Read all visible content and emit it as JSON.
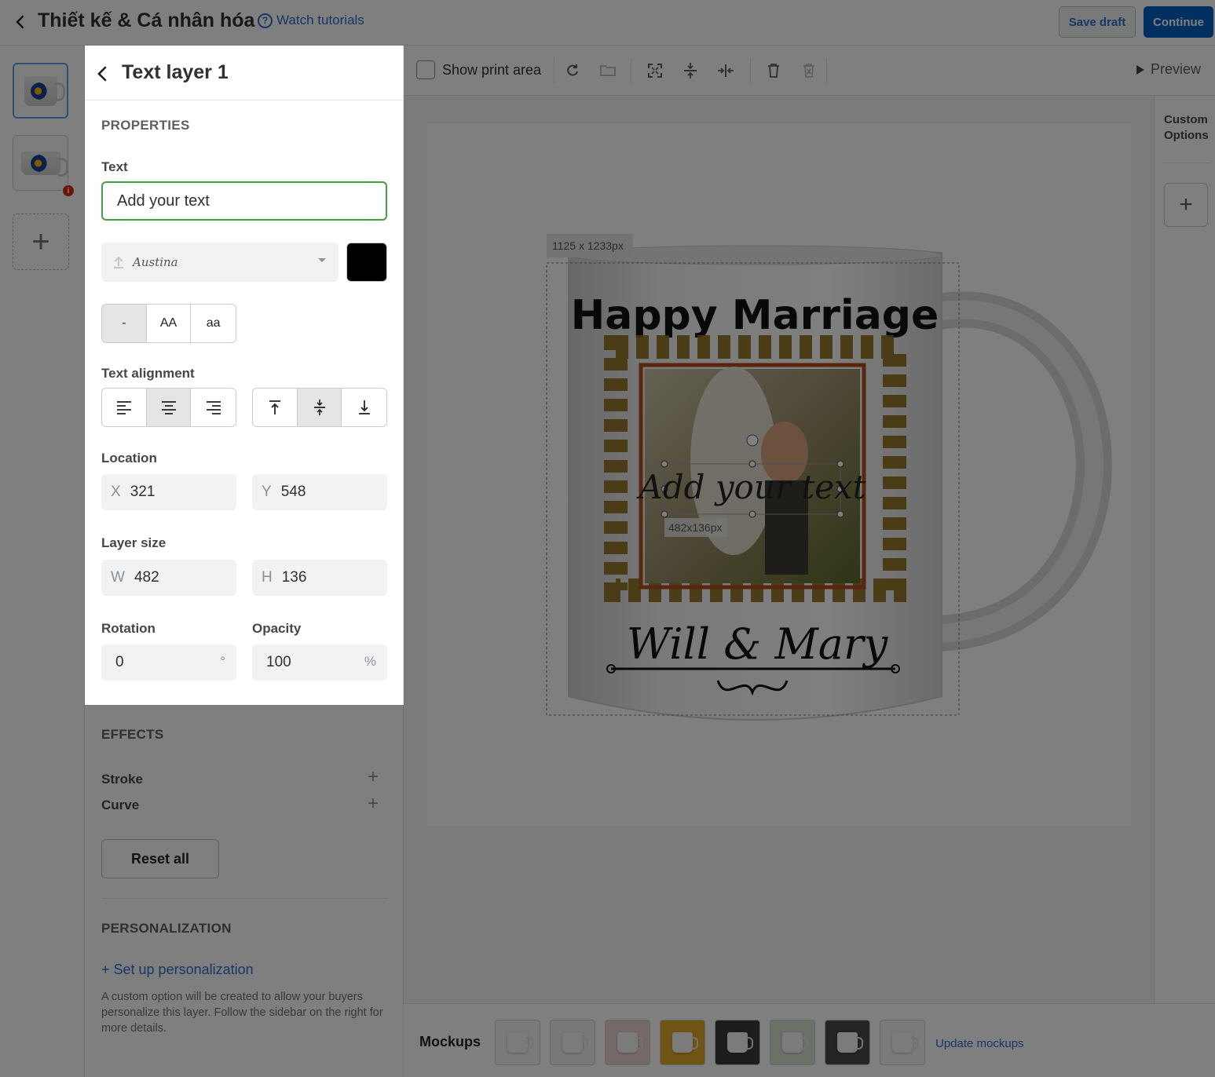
{
  "header": {
    "title": "Thiết kế & Cá nhân hóa",
    "help_link": "Watch tutorials",
    "save_draft": "Save draft",
    "continue": "Continue"
  },
  "panel": {
    "title": "Text layer 1",
    "properties_heading": "PROPERTIES",
    "text_label": "Text",
    "text_value": "Add your text",
    "font_name": "Austina",
    "text_color": "#000000",
    "case_options": [
      "-",
      "AA",
      "aa"
    ],
    "case_selected": "-",
    "alignment_label": "Text alignment",
    "horizontal_align_selected": "center",
    "vertical_align_selected": "middle",
    "location_label": "Location",
    "x_prefix": "X",
    "x_value": "321",
    "y_prefix": "Y",
    "y_value": "548",
    "layer_size_label": "Layer size",
    "w_prefix": "W",
    "w_value": "482",
    "h_prefix": "H",
    "h_value": "136",
    "rotation_label": "Rotation",
    "rotation_value": "0",
    "rotation_unit": "°",
    "opacity_label": "Opacity",
    "opacity_value": "100",
    "opacity_unit": "%",
    "effects_heading": "EFFECTS",
    "stroke_label": "Stroke",
    "curve_label": "Curve",
    "reset_all": "Reset all",
    "personalization_heading": "PERSONALIZATION",
    "setup_link": "+ Set up personalization",
    "help_text": "A custom option will be created to allow your buyers personalize this layer. Follow the sidebar on the right for more details."
  },
  "toolbar": {
    "show_print_area": "Show print area",
    "preview": "Preview"
  },
  "canvas": {
    "print_area_size": "1125 x 1233px",
    "layer_size_tag": "482x136px",
    "headline": "Happy Marriage",
    "layer_text": "Add your text",
    "names": "Will & Mary"
  },
  "right_rail": {
    "custom_options_line1": "Custom",
    "custom_options_line2": "Options"
  },
  "mockups": {
    "title": "Mockups",
    "update_link": "Update mockups"
  },
  "colors": {
    "accent": "#2c6ecb",
    "primary_button": "#0061c2",
    "focus_border": "#43a047",
    "error_badge": "#d72c0d"
  }
}
